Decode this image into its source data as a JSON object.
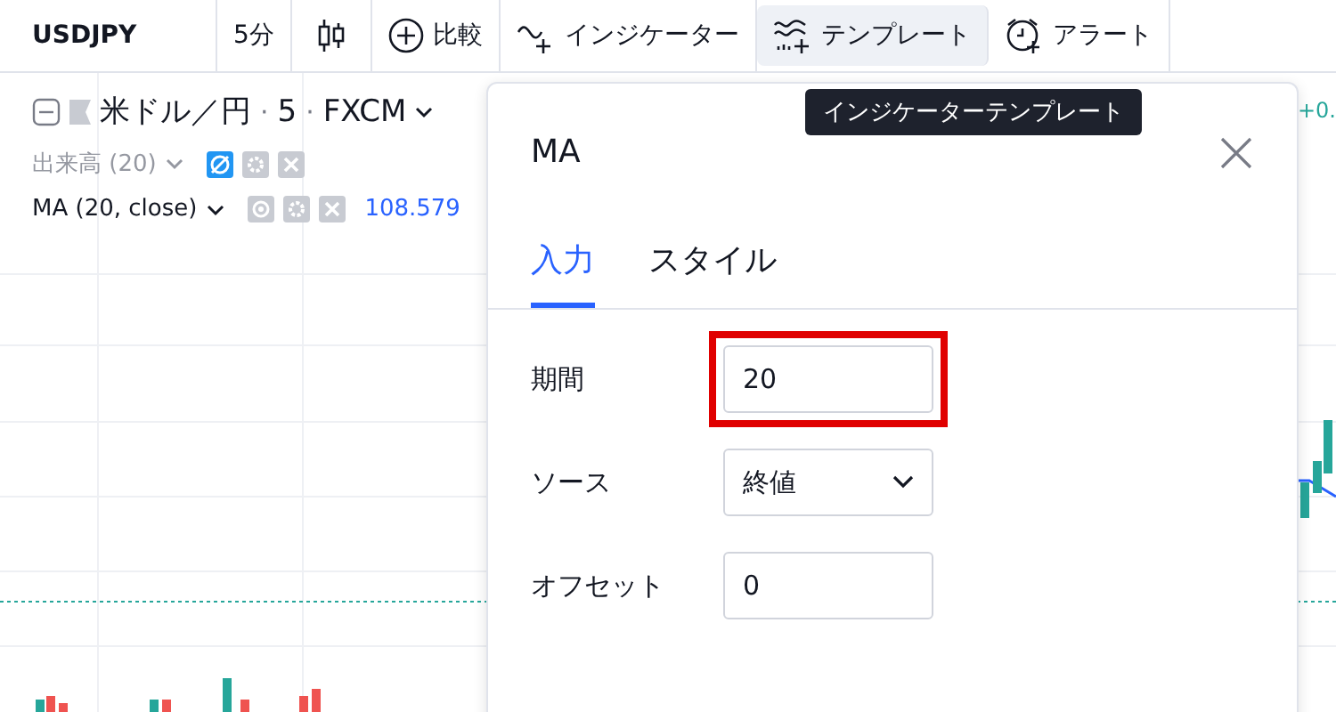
{
  "toolbar": {
    "symbol": "USDJPY",
    "interval": "5分",
    "buttons": [
      {
        "label": "比較",
        "kind": "compare",
        "selected": false
      },
      {
        "label": "インジケーター",
        "kind": "indicator",
        "selected": false
      },
      {
        "label": "テンプレート",
        "kind": "template",
        "selected": true
      },
      {
        "label": "アラート",
        "kind": "alert",
        "selected": false
      }
    ]
  },
  "tooltip": "インジケーターテンプレート",
  "legend": {
    "title": "米ドル／円",
    "separator_1": "·",
    "interval": "5",
    "separator_2": "·",
    "exchange": "FXCM",
    "change": "+0.",
    "studies": [
      {
        "name": "出来高 (20)",
        "hidden": true
      },
      {
        "name": "MA (20, close)",
        "hidden": false,
        "value": "108.579"
      }
    ]
  },
  "dialog": {
    "title": "MA",
    "tabs": [
      {
        "label": "入力",
        "selected": true
      },
      {
        "label": "スタイル",
        "selected": false
      }
    ],
    "fields": [
      {
        "label": "期間",
        "kind": "text",
        "value": "20",
        "highlighted": true
      },
      {
        "label": "ソース",
        "kind": "select",
        "value": "終値",
        "highlighted": false
      },
      {
        "label": "オフセット",
        "kind": "text",
        "value": "0",
        "highlighted": false
      }
    ]
  }
}
